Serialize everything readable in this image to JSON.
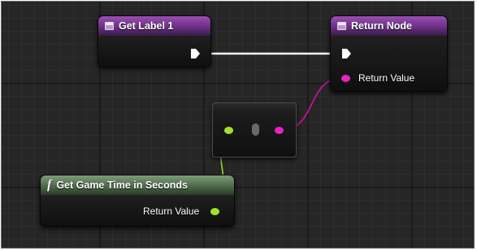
{
  "nodes": {
    "get_label": {
      "title": "Get Label 1"
    },
    "return_node": {
      "title": "Return Node",
      "return_value_label": "Return Value"
    },
    "get_game_time": {
      "title": "Get Game Time in Seconds",
      "return_value_label": "Return Value",
      "icon_glyph": "f"
    }
  },
  "colors": {
    "variable_header": "#7a3d93",
    "function_header": "#5c7a58",
    "exec_wire": "#ffffff",
    "float_pin": "#9bde2e",
    "string_pin": "#e21fb4"
  },
  "icons": {
    "variable": "variable-getter-icon",
    "function": "function-icon",
    "exec": "exec-pin-icon"
  }
}
